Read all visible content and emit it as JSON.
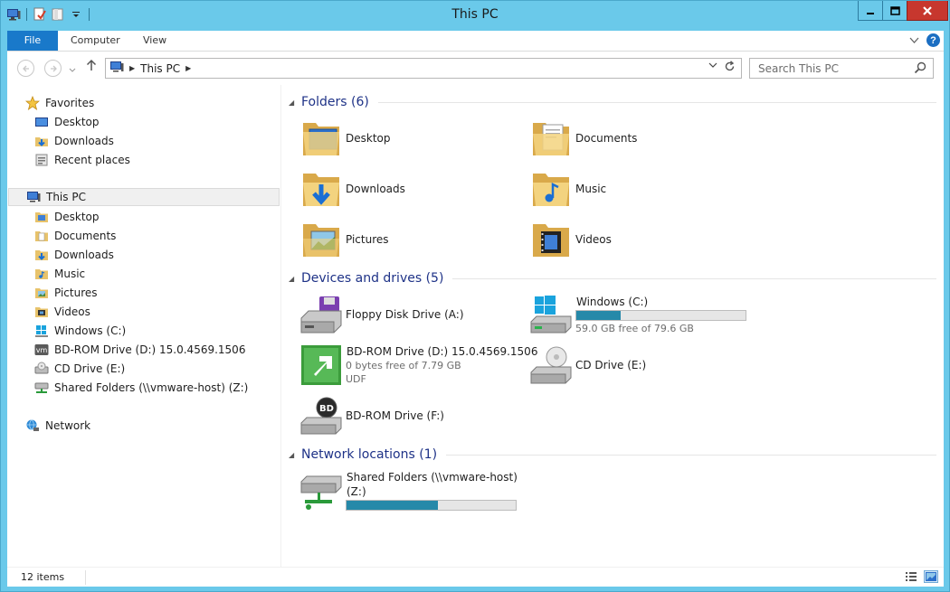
{
  "window": {
    "title": "This PC",
    "buttons": [
      "minimize-icon",
      "maximize-icon",
      "close-icon"
    ]
  },
  "colors": {
    "frame": "#6ac9ea",
    "file_tab": "#1979ca",
    "group_title": "#1e3287",
    "drive_bar": "#2689a9",
    "close_button": "#c7372e"
  },
  "ribbon": {
    "tabs": [
      "File",
      "Computer",
      "View"
    ]
  },
  "addressbar": {
    "path": "This PC",
    "search_placeholder": "Search This PC"
  },
  "navpane": {
    "favorites": {
      "label": "Favorites",
      "items": [
        "Desktop",
        "Downloads",
        "Recent places"
      ]
    },
    "thispc": {
      "label": "This PC",
      "items": [
        {
          "label": "Desktop",
          "icon": "folder-icon"
        },
        {
          "label": "Documents",
          "icon": "folder-icon"
        },
        {
          "label": "Downloads",
          "icon": "folder-icon"
        },
        {
          "label": "Music",
          "icon": "folder-icon"
        },
        {
          "label": "Pictures",
          "icon": "folder-icon"
        },
        {
          "label": "Videos",
          "icon": "folder-icon"
        },
        {
          "label": "Windows (C:)",
          "icon": "windows-drive-icon"
        },
        {
          "label": "BD-ROM Drive (D:) 15.0.4569.1506",
          "icon": "vm-drive-icon"
        },
        {
          "label": "CD Drive (E:)",
          "icon": "cd-drive-icon"
        },
        {
          "label": "Shared Folders (\\\\vmware-host) (Z:)",
          "icon": "network-drive-icon"
        }
      ]
    },
    "network": {
      "label": "Network"
    }
  },
  "content": {
    "folders": {
      "title": "Folders (6)",
      "items": [
        "Desktop",
        "Documents",
        "Downloads",
        "Music",
        "Pictures",
        "Videos"
      ]
    },
    "devices": {
      "title": "Devices and drives (5)",
      "floppy": {
        "label": "Floppy Disk Drive (A:)"
      },
      "windows": {
        "label": "Windows (C:)",
        "free": "59.0 GB free of 79.6 GB",
        "used_fraction": 0.26
      },
      "bdrom_d": {
        "label": "BD-ROM Drive (D:) 15.0.4569.1506",
        "free": "0 bytes free of 7.79 GB",
        "fs": "UDF"
      },
      "cd": {
        "label": "CD Drive (E:)"
      },
      "bdrom_f": {
        "label": "BD-ROM Drive (F:)"
      }
    },
    "network": {
      "title": "Network locations (1)",
      "shared": {
        "label_line1": "Shared Folders (\\\\vmware-host)",
        "label_line2": "(Z:)",
        "used_fraction": 0.54
      }
    }
  },
  "statusbar": {
    "count": "12 items"
  }
}
